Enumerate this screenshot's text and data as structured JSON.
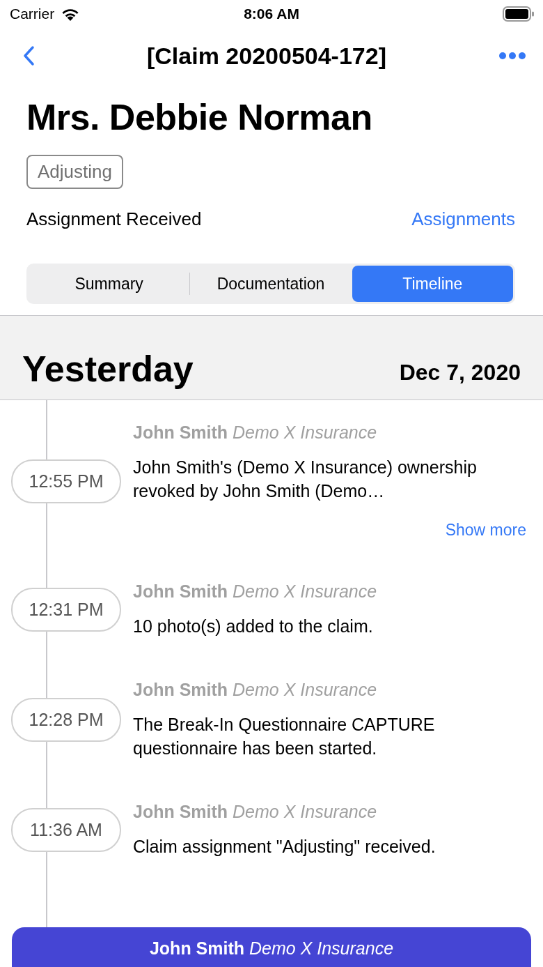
{
  "status_bar": {
    "carrier": "Carrier",
    "time": "8:06 AM"
  },
  "nav": {
    "title": "[Claim 20200504-172]"
  },
  "claimant": {
    "name": "Mrs. Debbie Norman",
    "status_badge": "Adjusting",
    "assignment_status": "Assignment Received",
    "assignments_link": "Assignments"
  },
  "tabs": [
    {
      "label": "Summary",
      "selected": false
    },
    {
      "label": "Documentation",
      "selected": false
    },
    {
      "label": "Timeline",
      "selected": true
    }
  ],
  "section": {
    "title": "Yesterday",
    "date": "Dec 7, 2020"
  },
  "entries": [
    {
      "time": "12:55 PM",
      "author": "**John Smith** *Demo X Insurance*",
      "text": "John Smith's (Demo X Insurance) ownership revoked by John Smith (Demo…",
      "action": "Show more"
    },
    {
      "time": "12:31 PM",
      "author": "**John Smith** *Demo X Insurance*",
      "text": "10 photo(s) added to the claim."
    },
    {
      "time": "12:28 PM",
      "author": "**John Smith** *Demo X Insurance*",
      "text": "The Break-In Questionnaire CAPTURE questionnaire has been started."
    },
    {
      "time": "11:36 AM",
      "author": "**John Smith** *Demo X Insurance*",
      "text": "Claim assignment \"Adjusting\" received."
    }
  ],
  "bottom_bar": {
    "label": "**John Smith** *Demo X Insurance*"
  }
}
